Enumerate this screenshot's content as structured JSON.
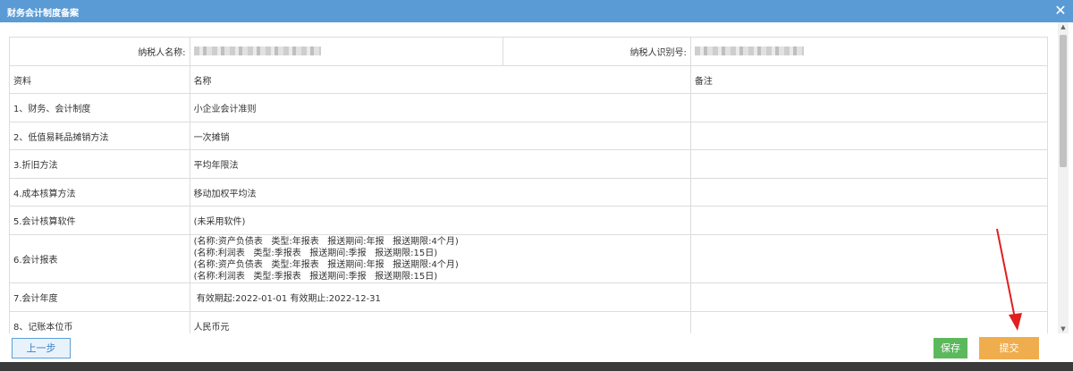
{
  "window": {
    "title": "财务会计制度备案"
  },
  "header": {
    "taxpayer_name_label": "纳税人名称:",
    "taxpayer_id_label": "纳税人识别号:"
  },
  "columns": {
    "material": "资料",
    "name": "名称",
    "remark": "备注"
  },
  "rows": [
    {
      "material": "1、财务、会计制度",
      "name": "小企业会计准则",
      "remark": ""
    },
    {
      "material": "2、低值易耗品摊销方法",
      "name": "一次摊销",
      "remark": ""
    },
    {
      "material": "3.折旧方法",
      "name": "平均年限法",
      "remark": ""
    },
    {
      "material": "4.成本核算方法",
      "name": "移动加权平均法",
      "remark": ""
    },
    {
      "material": "5.会计核算软件",
      "name": "(未采用软件)",
      "remark": ""
    },
    {
      "material": "6.会计报表",
      "name_lines": [
        "(名称:资产负债表   类型:年报表   报送期间:年报   报送期限:4个月)",
        "(名称:利润表   类型:季报表   报送期间:季报   报送期限:15日)",
        "(名称:资产负债表   类型:年报表   报送期间:年报   报送期限:4个月)",
        "(名称:利润表   类型:季报表   报送期间:季报   报送期限:15日)"
      ],
      "remark": ""
    },
    {
      "material": "7.会计年度",
      "name": " 有效期起:2022-01-01 有效期止:2022-12-31",
      "remark": ""
    },
    {
      "material": "8、记账本位币",
      "name": "人民币元",
      "remark": ""
    }
  ],
  "buttons": {
    "prev": "上一步",
    "save": "保存",
    "submit": "提交"
  },
  "colors": {
    "titlebar": "#5b9bd5",
    "save": "#5cb85c",
    "submit": "#f0ad4e",
    "arrow": "#e02020"
  }
}
